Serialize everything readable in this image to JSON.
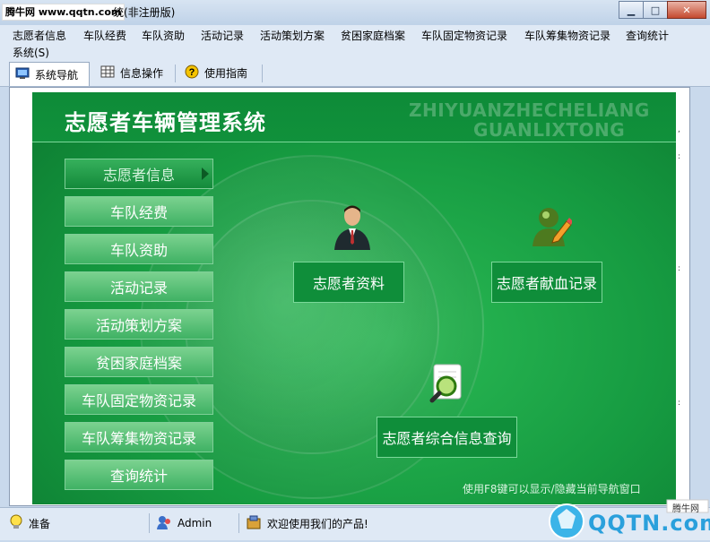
{
  "titlebar": {
    "watermark": "腾牛网 www.qqtn.com",
    "title_suffix": "统(非注册版)",
    "min_icon": "▁",
    "max_icon": "□",
    "close_icon": "✕"
  },
  "menu": {
    "row1": [
      "志愿者信息",
      "车队经费",
      "车队资助",
      "活动记录",
      "活动策划方案",
      "贫困家庭档案",
      "车队固定物资记录",
      "车队筹集物资记录",
      "查询统计"
    ],
    "row2": [
      "系统(S)"
    ]
  },
  "toolbar": {
    "tabs": [
      {
        "label": "系统导航",
        "icon": "monitor-icon"
      },
      {
        "label": "信息操作",
        "icon": "grid-icon"
      },
      {
        "label": "使用指南",
        "icon": "help-icon"
      }
    ]
  },
  "panel": {
    "title": "志愿者车辆管理系统",
    "pinyin_line1": "ZHIYUANZHECHELIANG",
    "pinyin_line2": "GUANLIXTONG",
    "nav_items": [
      "志愿者信息",
      "车队经费",
      "车队资助",
      "活动记录",
      "活动策划方案",
      "贫困家庭档案",
      "车队固定物资记录",
      "车队筹集物资记录",
      "查询统计"
    ],
    "features": [
      {
        "label": "志愿者资料",
        "icon": "person-icon"
      },
      {
        "label": "志愿者献血记录",
        "icon": "user-edit-icon"
      },
      {
        "label": "志愿者综合信息查询",
        "icon": "magnifier-icon"
      }
    ],
    "hint": "使用F8键可以显示/隐藏当前导航窗口"
  },
  "status": {
    "ready": "准备",
    "user": "Admin",
    "message": "欢迎使用我们的产品!",
    "watermark_top": "腾牛网",
    "watermark_logo": "QQTN.com"
  },
  "colors": {
    "panel_green": "#169b41",
    "nav_light": "#5cc27a",
    "chrome": "#dfe9f5"
  }
}
